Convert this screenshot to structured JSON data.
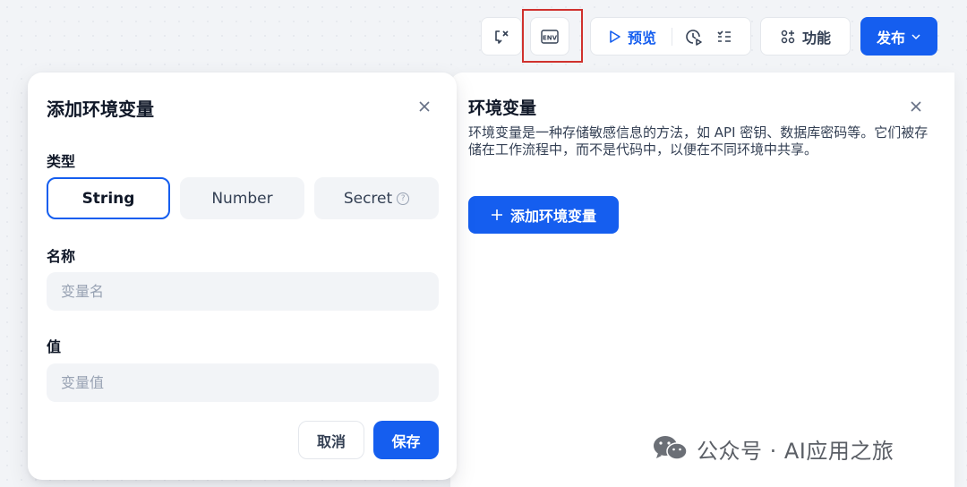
{
  "toolbar": {
    "preview_label": "预览",
    "feature_label": "功能",
    "publish_label": "发布",
    "env_icon_text": "ENV"
  },
  "dialog": {
    "title": "添加环境变量",
    "type_label": "类型",
    "type_options": [
      "String",
      "Number",
      "Secret"
    ],
    "selected_type": "String",
    "secret_help": "?",
    "name_label": "名称",
    "name_placeholder": "变量名",
    "name_value": "",
    "value_label": "值",
    "value_placeholder": "变量值",
    "value_value": "",
    "cancel_label": "取消",
    "save_label": "保存"
  },
  "panel": {
    "title": "环境变量",
    "description": "环境变量是一种存储敏感信息的方法，如 API 密钥、数据库密码等。它们被存储在工作流程中，而不是代码中，以便在不同环境中共享。",
    "add_button_label": "添加环境变量"
  },
  "watermark": {
    "text": "公众号 · AI应用之旅"
  },
  "colors": {
    "accent": "#155eef",
    "highlight": "#d0312d"
  }
}
